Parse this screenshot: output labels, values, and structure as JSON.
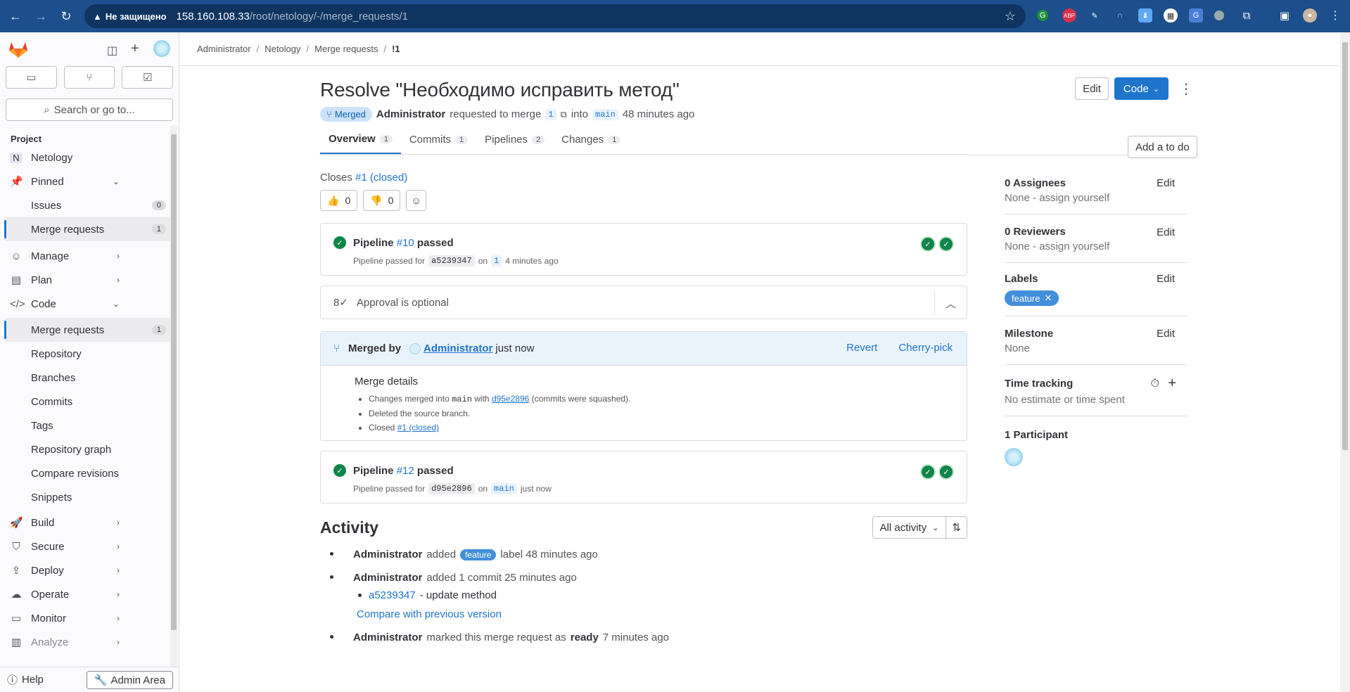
{
  "browser": {
    "insecure_label": "Не защищено",
    "url_host": "158.160.108.33",
    "url_path": "/root/netology/-/merge_requests/1"
  },
  "sidebar": {
    "search_placeholder": "Search or go to...",
    "section_label": "Project",
    "project_initial": "N",
    "project_name": "Netology",
    "pinned": "Pinned",
    "pinned_items": [
      {
        "label": "Issues",
        "count": "0"
      },
      {
        "label": "Merge requests",
        "count": "1"
      }
    ],
    "manage": "Manage",
    "plan": "Plan",
    "code": "Code",
    "code_items": [
      {
        "label": "Merge requests",
        "count": "1"
      },
      {
        "label": "Repository"
      },
      {
        "label": "Branches"
      },
      {
        "label": "Commits"
      },
      {
        "label": "Tags"
      },
      {
        "label": "Repository graph"
      },
      {
        "label": "Compare revisions"
      },
      {
        "label": "Snippets"
      }
    ],
    "build": "Build",
    "secure": "Secure",
    "deploy": "Deploy",
    "operate": "Operate",
    "monitor": "Monitor",
    "analyze": "Analyze",
    "help": "Help",
    "admin_area": "Admin Area"
  },
  "breadcrumb": [
    "Administrator",
    "Netology",
    "Merge requests",
    "!1"
  ],
  "mr": {
    "title": "Resolve \"Необходимо исправить метод\"",
    "status": "Merged",
    "author": "Administrator",
    "requested_text": "requested to merge",
    "source_branch": "1",
    "into_text": "into",
    "target_branch": "main",
    "time": "48 minutes ago",
    "edit_btn": "Edit",
    "code_btn": "Code",
    "todo_btn": "Add a to do"
  },
  "tabs": [
    {
      "label": "Overview",
      "count": "1"
    },
    {
      "label": "Commits",
      "count": "1"
    },
    {
      "label": "Pipelines",
      "count": "2"
    },
    {
      "label": "Changes",
      "count": "1"
    }
  ],
  "closes": {
    "text": "Closes",
    "link": "#1 (closed)"
  },
  "reactions": {
    "thumbs_up": "0",
    "thumbs_down": "0"
  },
  "pipeline1": {
    "label": "Pipeline",
    "id": "#10",
    "status": "passed",
    "sub_text": "Pipeline passed for",
    "sha": "a5239347",
    "on": "on",
    "ref": "1",
    "time": "4 minutes ago"
  },
  "approval": "Approval is optional",
  "merged": {
    "by_text": "Merged by",
    "user": "Administrator",
    "time": "just now",
    "revert": "Revert",
    "cherry_pick": "Cherry-pick",
    "details_title": "Merge details",
    "d1_pre": "Changes merged into",
    "d1_branch": "main",
    "d1_with": "with",
    "d1_sha": "d95e2896",
    "d1_post": "(commits were squashed).",
    "d2": "Deleted the source branch.",
    "d3_pre": "Closed",
    "d3_link": "#1 (closed)"
  },
  "pipeline2": {
    "label": "Pipeline",
    "id": "#12",
    "status": "passed",
    "sub_text": "Pipeline passed for",
    "sha": "d95e2896",
    "on": "on",
    "ref": "main",
    "time": "just now"
  },
  "activity": {
    "title": "Activity",
    "filter": "All activity",
    "items": [
      {
        "user": "Administrator",
        "pre": "added",
        "label": "feature",
        "post": "label 48 minutes ago"
      },
      {
        "user": "Administrator",
        "text": "added 1 commit 25 minutes ago"
      },
      {
        "commit_sha": "a5239347",
        "commit_msg": "- update method"
      },
      {
        "compare": "Compare with previous version"
      },
      {
        "user": "Administrator",
        "pre": "marked this merge request as",
        "bold": "ready",
        "post": "7 minutes ago"
      }
    ]
  },
  "right": {
    "assignees": "0 Assignees",
    "assignees_val": "None - assign yourself",
    "reviewers": "0 Reviewers",
    "reviewers_val": "None - assign yourself",
    "labels": "Labels",
    "label_chip": "feature",
    "milestone": "Milestone",
    "milestone_val": "None",
    "time_tracking": "Time tracking",
    "time_val": "No estimate or time spent",
    "participants": "1 Participant",
    "edit": "Edit"
  },
  "colors": {
    "accent": "#1f75cb",
    "success": "#108548",
    "label": "#428fdc"
  }
}
